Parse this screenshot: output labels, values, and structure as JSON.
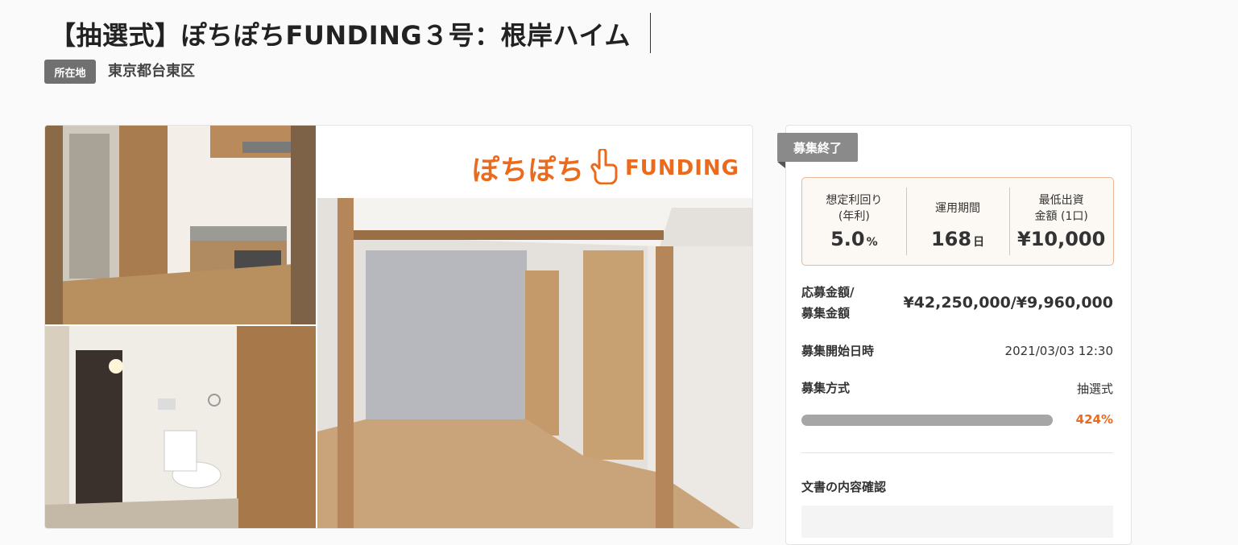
{
  "page": {
    "title": "【抽選式】ぽちぽちFUNDING３号：根岸ハイム",
    "location_label": "所在地",
    "location_value": "東京都台東区"
  },
  "gallery": {
    "brand_kana": "ぽちぽち",
    "brand_word": "FUNDING"
  },
  "panel": {
    "status": "募集終了",
    "stats": [
      {
        "label": "想定利回り\n(年利)",
        "value": "5.0",
        "unit": "%"
      },
      {
        "label": "運用期間",
        "value": "168",
        "unit": "日"
      },
      {
        "label": "最低出資\n金額 (1口)",
        "value": "¥10,000",
        "unit": ""
      }
    ],
    "amount_label": "応募金額/\n募集金額",
    "amount_value": "¥42,250,000/¥9,960,000",
    "start_label": "募集開始日時",
    "start_value": "2021/03/03 12:30",
    "method_label": "募集方式",
    "method_value": "抽選式",
    "progress_percent_text": "424%",
    "progress_fraction": 1.0,
    "doc_title": "文書の内容確認"
  },
  "colors": {
    "accent": "#ec6a1c",
    "badge": "#707070",
    "status": "#8a8a8a",
    "progress": "#a6a6a6"
  }
}
